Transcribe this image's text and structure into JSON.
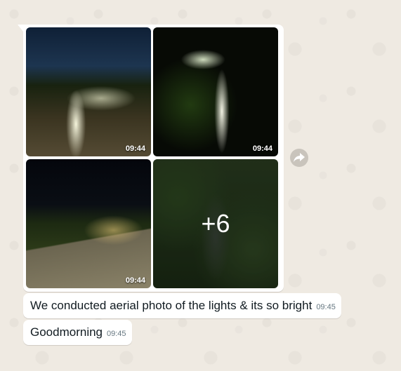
{
  "album": {
    "photos": [
      {
        "time": "09:44"
      },
      {
        "time": "09:44"
      },
      {
        "time": "09:44"
      },
      {
        "overlay": "+6"
      }
    ]
  },
  "messages": [
    {
      "text": "We conducted aerial photo of the lights & its so bright",
      "time": "09:45"
    },
    {
      "text": "Goodmorning",
      "time": "09:45"
    }
  ],
  "icons": {
    "forward": "forward-arrow-icon"
  },
  "colors": {
    "chat_background": "#efeae2",
    "bubble": "#ffffff",
    "timestamp": "#667781"
  }
}
